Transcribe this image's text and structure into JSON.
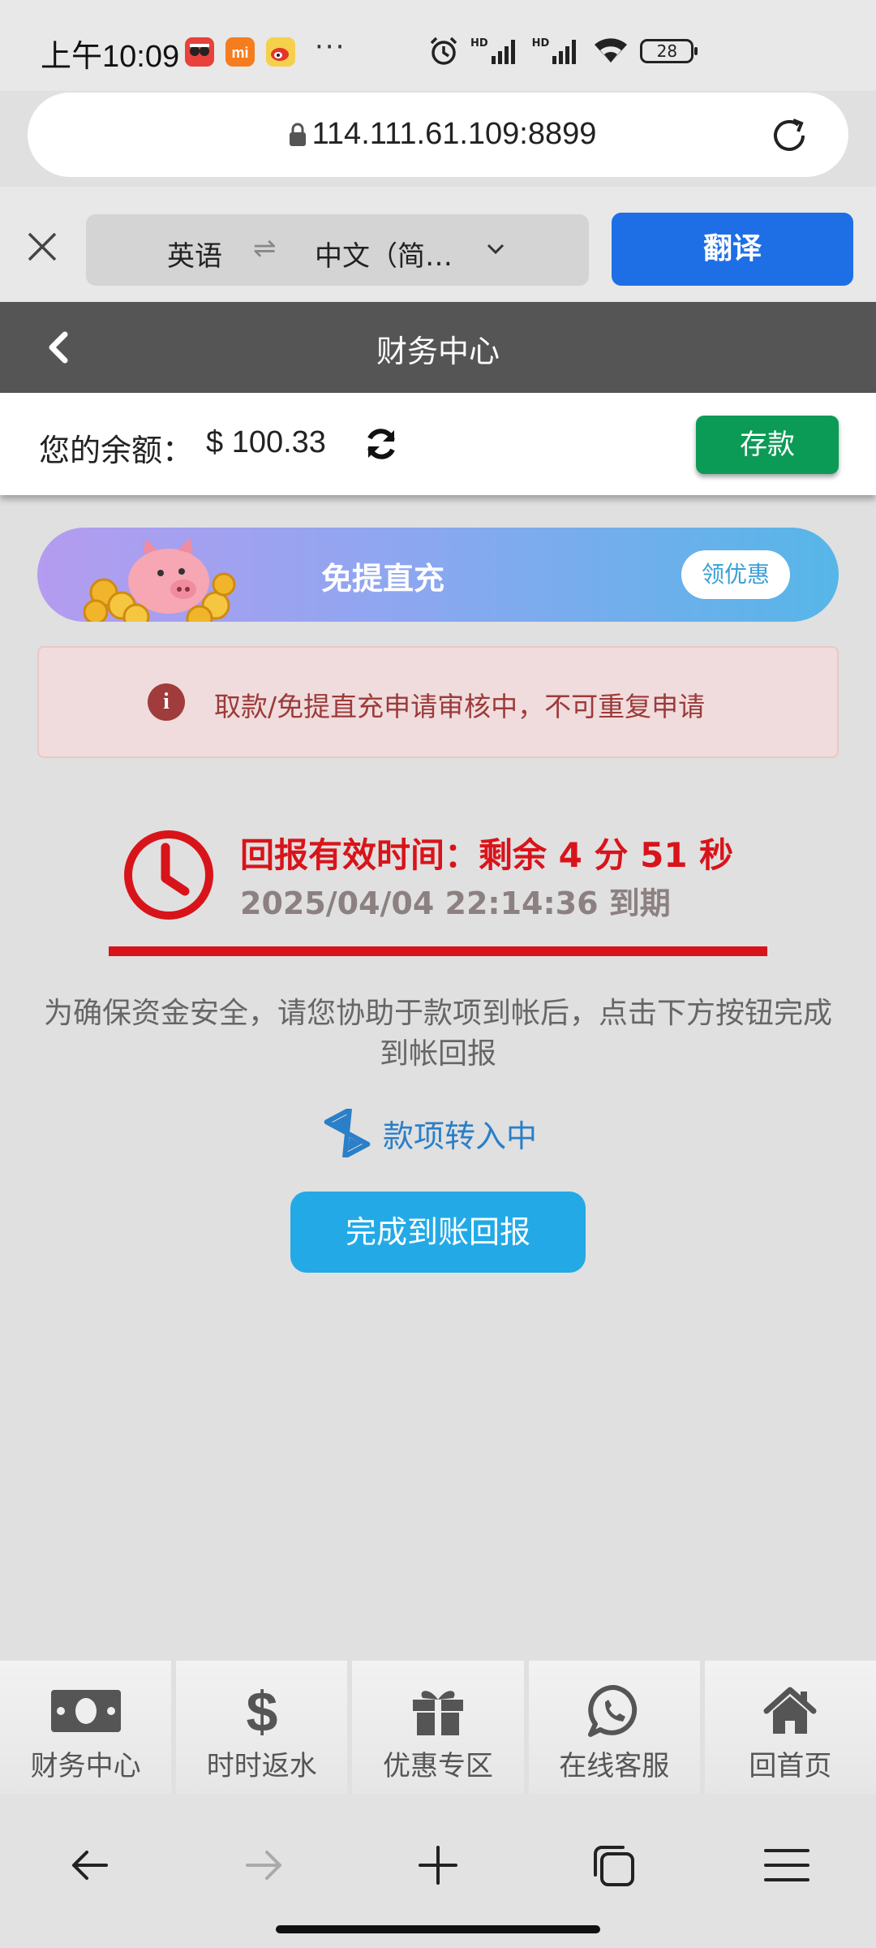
{
  "status_bar": {
    "time": "上午10:09",
    "more": "···",
    "battery": "28",
    "hd_label": "HD"
  },
  "browser": {
    "url": "114.111.61.109:8899"
  },
  "translate_bar": {
    "source_lang": "英语",
    "swap": "⇌",
    "target_lang": "中文（简…",
    "translate_button": "翻译"
  },
  "header": {
    "title": "财务中心"
  },
  "balance": {
    "label": "您的余额：",
    "amount": "$ 100.33",
    "deposit_button": "存款"
  },
  "promo": {
    "title": "免提直充",
    "button": "领优惠"
  },
  "alert": {
    "icon": "i",
    "text": "取款/免提直充申请审核中，不可重复申请"
  },
  "countdown": {
    "line1": "回报有效时间：剩余 4 分 51 秒",
    "line2": "2025/04/04 22:14:36 到期"
  },
  "notice": {
    "text": "为确保资金安全，请您协助于款项到帐后，点击下方按钮完成到帐回报"
  },
  "transfer": {
    "status": "款项转入中"
  },
  "report_button": "完成到账回报",
  "bottom_nav": {
    "items": [
      {
        "label": "财务中心",
        "icon": "money-icon"
      },
      {
        "label": "时时返水",
        "icon": "dollar-icon"
      },
      {
        "label": "优惠专区",
        "icon": "gift-icon"
      },
      {
        "label": "在线客服",
        "icon": "whatsapp-icon"
      },
      {
        "label": "回首页",
        "icon": "home-icon"
      }
    ]
  },
  "colors": {
    "translate_blue": "#1e6fe6",
    "deposit_green": "#0c9b56",
    "countdown_red": "#d8141a",
    "report_button_blue": "#23aae6",
    "header_gray": "#555555"
  }
}
